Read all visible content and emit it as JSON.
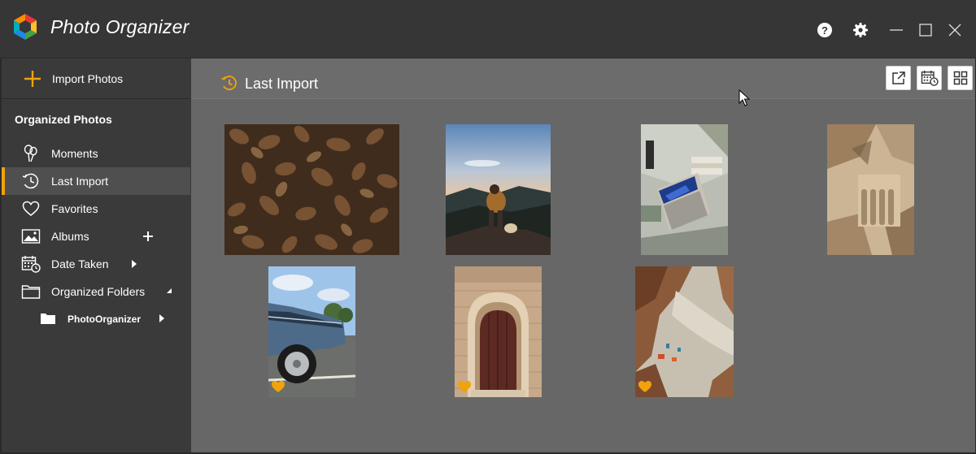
{
  "app": {
    "title": "Photo Organizer"
  },
  "window_controls": {
    "icons": [
      "help-icon",
      "settings-gear-icon",
      "minimize-icon",
      "maximize-icon",
      "close-icon"
    ]
  },
  "sidebar": {
    "import_label": "Import Photos",
    "section_title": "Organized Photos",
    "items": [
      {
        "label": "Moments",
        "icon": "balloons-icon"
      },
      {
        "label": "Last Import",
        "icon": "clock-icon",
        "active": true
      },
      {
        "label": "Favorites",
        "icon": "heart-outline-icon"
      },
      {
        "label": "Albums",
        "icon": "image-icon",
        "extra": "plus"
      },
      {
        "label": "Date Taken",
        "icon": "calendar-clock-icon",
        "extra": "expand-arrow"
      },
      {
        "label": "Organized Folders",
        "icon": "folder-outline-icon",
        "extra": "collapse-arrow"
      }
    ],
    "sub_items": [
      {
        "label": "PhotoOrganizer",
        "icon": "folder-filled-icon"
      }
    ]
  },
  "main": {
    "header_title": "Last Import",
    "toolbar": [
      "open-external-icon",
      "calendar-clock-icon",
      "grid-view-icon"
    ],
    "photos": [
      {
        "subject": "autumn leaves",
        "favorite": false
      },
      {
        "subject": "hiker on mountain at sunset",
        "favorite": false
      },
      {
        "subject": "laptop on desk",
        "favorite": false
      },
      {
        "subject": "cliffside aqueduct bridge",
        "favorite": false
      },
      {
        "subject": "vintage blue car",
        "favorite": true
      },
      {
        "subject": "arched wooden door",
        "favorite": true
      },
      {
        "subject": "aerial beach",
        "favorite": true
      }
    ]
  },
  "colors": {
    "accent": "#f0a30a",
    "titlebar": "#363636",
    "sidebar": "#3a3a3a",
    "content": "#676767"
  }
}
